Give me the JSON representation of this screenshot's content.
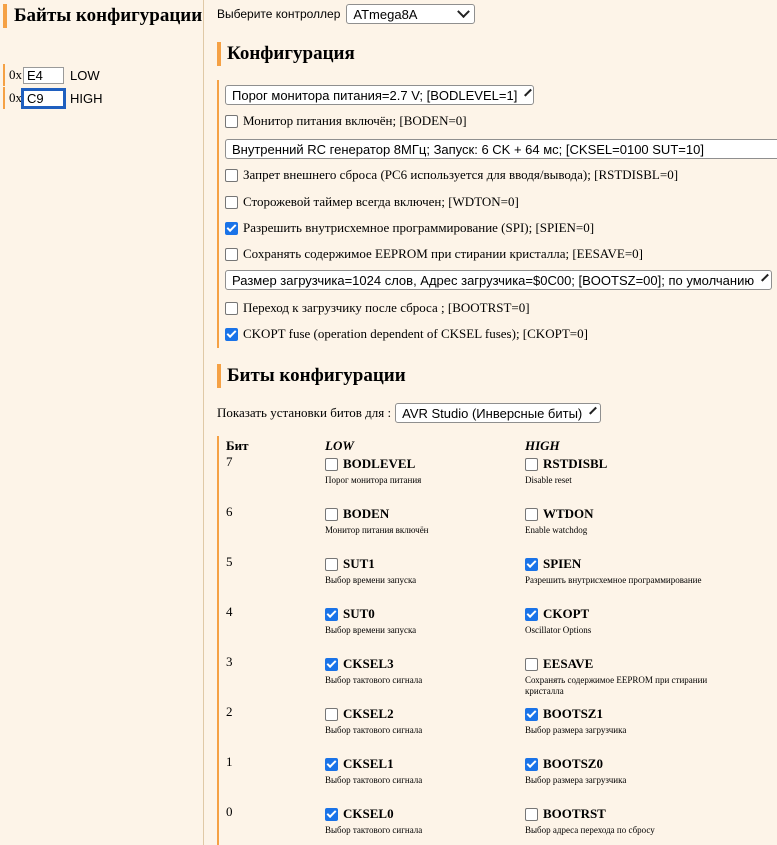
{
  "left_panel": {
    "title": "Байты конфигурации",
    "bytes": [
      {
        "prefix": "0x",
        "value": "E4",
        "label": "LOW"
      },
      {
        "prefix": "0x",
        "value": "C9",
        "label": "HIGH"
      }
    ]
  },
  "controller": {
    "label": "Выберите контроллер",
    "selected": "ATmega8A"
  },
  "config_section": {
    "title": "Конфигурация",
    "options": [
      {
        "type": "select",
        "text": "Порог монитора питания=2.7 V; [BODLEVEL=1]"
      },
      {
        "type": "checkbox",
        "checked": false,
        "text": "Монитор питания включён; [BODEN=0]"
      },
      {
        "type": "select",
        "text": "Внутренний RC генератор 8МГц; Запуск: 6 CK + 64 мс; [CKSEL=0100 SUT=10]"
      },
      {
        "type": "checkbox",
        "checked": false,
        "text": "Запрет внешнего сброса (PC6 используется для вводя/вывода); [RSTDISBL=0]"
      },
      {
        "type": "checkbox",
        "checked": false,
        "text": "Сторожевой таймер всегда включен; [WDTON=0]"
      },
      {
        "type": "checkbox",
        "checked": true,
        "text": "Разрешить внутрисхемное программирование (SPI); [SPIEN=0]"
      },
      {
        "type": "checkbox",
        "checked": false,
        "text": "Сохранять содержимое EEPROM при стирании кристалла; [EESAVE=0]"
      },
      {
        "type": "select",
        "text": "Размер загрузчика=1024 слов, Адрес загрузчика=$0C00; [BOOTSZ=00]; по умолчанию"
      },
      {
        "type": "checkbox",
        "checked": false,
        "text": "Переход к загрузчику после сброса ; [BOOTRST=0]"
      },
      {
        "type": "checkbox",
        "checked": true,
        "text": "CKOPT fuse (operation dependent of CKSEL fuses); [CKOPT=0]"
      }
    ]
  },
  "bits_section": {
    "title": "Биты конфигурации",
    "show_label": "Показать установки битов для :",
    "show_selected": "AVR Studio (Инверсные биты)",
    "col_bit": "Бит",
    "col_low": "LOW",
    "col_high": "HIGH",
    "rows": [
      {
        "bit": "7",
        "low": {
          "name": "BODLEVEL",
          "checked": false,
          "desc": "Порог монитора питания"
        },
        "high": {
          "name": "RSTDISBL",
          "checked": false,
          "desc": "Disable reset"
        }
      },
      {
        "bit": "6",
        "low": {
          "name": "BODEN",
          "checked": false,
          "desc": "Монитор питания включён"
        },
        "high": {
          "name": "WTDON",
          "checked": false,
          "desc": "Enable watchdog"
        }
      },
      {
        "bit": "5",
        "low": {
          "name": "SUT1",
          "checked": false,
          "desc": "Выбор времени запуска"
        },
        "high": {
          "name": "SPIEN",
          "checked": true,
          "desc": "Разрешить внутрисхемное программирование"
        }
      },
      {
        "bit": "4",
        "low": {
          "name": "SUT0",
          "checked": true,
          "desc": "Выбор времени запуска"
        },
        "high": {
          "name": "CKOPT",
          "checked": true,
          "desc": "Oscillator Options"
        }
      },
      {
        "bit": "3",
        "low": {
          "name": "CKSEL3",
          "checked": true,
          "desc": "Выбор тактового сигнала"
        },
        "high": {
          "name": "EESAVE",
          "checked": false,
          "desc": "Сохранять содержимое EEPROM при стирании кристалла"
        }
      },
      {
        "bit": "2",
        "low": {
          "name": "CKSEL2",
          "checked": false,
          "desc": "Выбор тактового сигнала"
        },
        "high": {
          "name": "BOOTSZ1",
          "checked": true,
          "desc": "Выбор размера загрузчика"
        }
      },
      {
        "bit": "1",
        "low": {
          "name": "CKSEL1",
          "checked": true,
          "desc": "Выбор тактового сигнала"
        },
        "high": {
          "name": "BOOTSZ0",
          "checked": true,
          "desc": "Выбор размера загрузчика"
        }
      },
      {
        "bit": "0",
        "low": {
          "name": "CKSEL0",
          "checked": true,
          "desc": "Выбор тактового сигнала"
        },
        "high": {
          "name": "BOOTRST",
          "checked": false,
          "desc": "Выбор адреса перехода по сбросу"
        }
      }
    ]
  }
}
